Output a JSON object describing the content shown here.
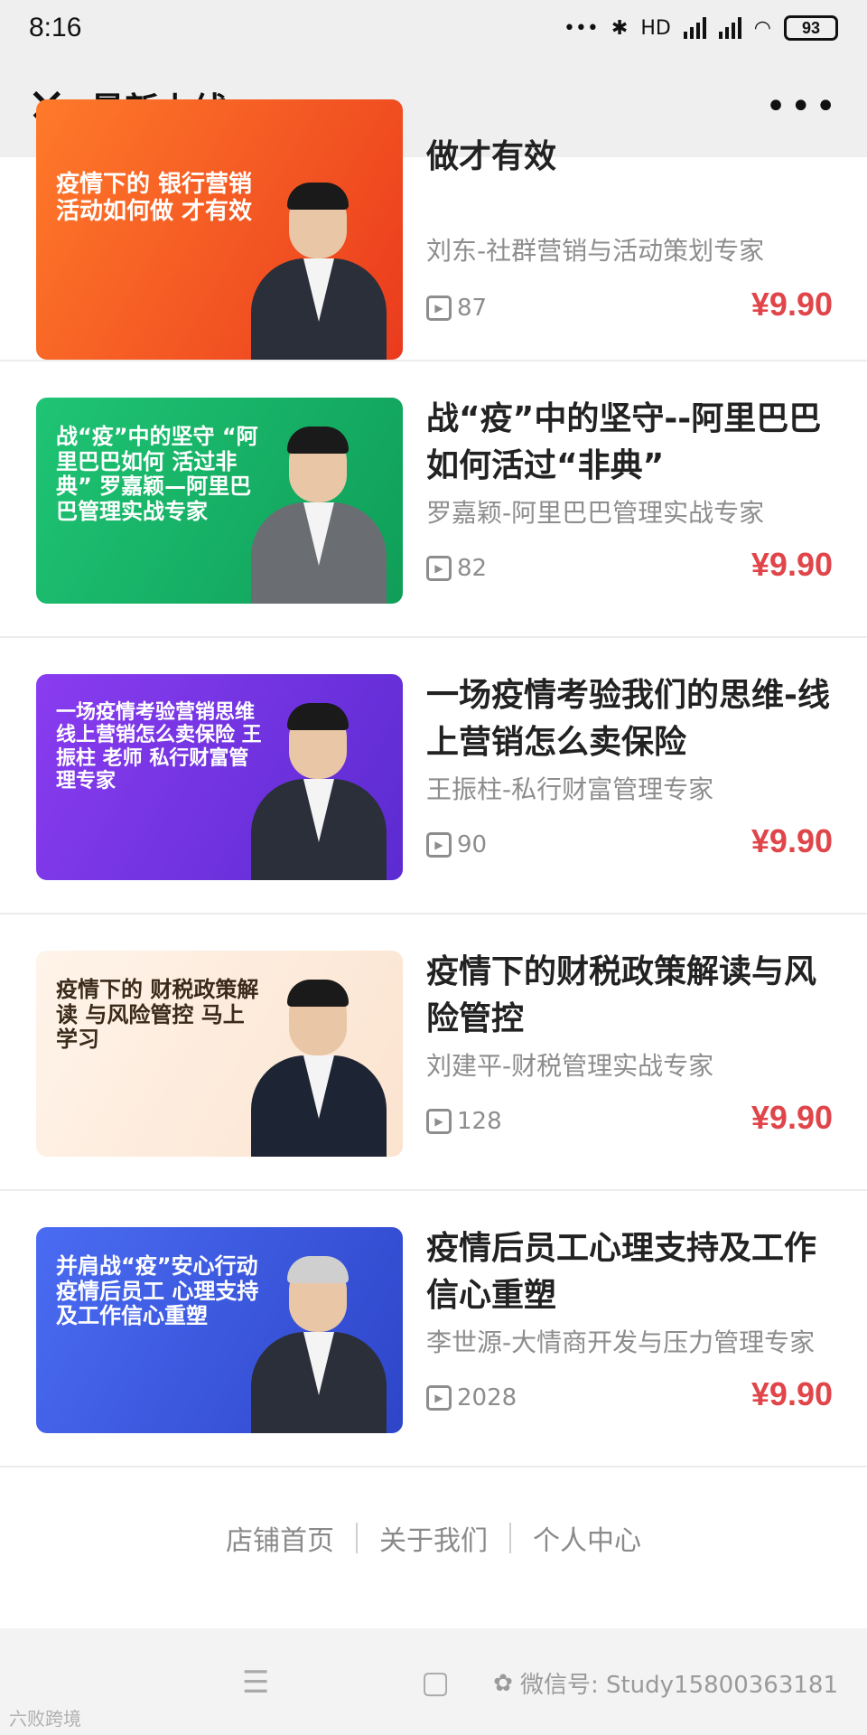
{
  "status_bar": {
    "time": "8:16",
    "signal_label": "HD",
    "battery": "93"
  },
  "header": {
    "title": "最新上线",
    "close_icon": "close-icon",
    "more_icon": "more-icon"
  },
  "courses": [
    {
      "title": "做才有效",
      "author": "刘东-社群营销与活动策划专家",
      "plays": "87",
      "price": "¥9.90",
      "thumb_text": "疫情下的 银行营销活动如何做 才有效",
      "thumb_color": "#f15a24"
    },
    {
      "title": "战“疫”中的坚守--阿里巴巴如何活过“非典”",
      "author": "罗嘉颖-阿里巴巴管理实战专家",
      "plays": "82",
      "price": "¥9.90",
      "thumb_text": "战“疫”中的坚守 “阿里巴巴如何 活过非典” 罗嘉颖—阿里巴巴管理实战专家",
      "thumb_color": "#1fb86b"
    },
    {
      "title": "一场疫情考验我们的思维-线上营销怎么卖保险",
      "author": "王振柱-私行财富管理专家",
      "plays": "90",
      "price": "¥9.90",
      "thumb_text": "一场疫情考验营销思维 线上营销怎么卖保险 王振柱 老师 私行财富管理专家",
      "thumb_color": "#7a3de0"
    },
    {
      "title": "疫情下的财税政策解读与风险管控",
      "author": "刘建平-财税管理实战专家",
      "plays": "128",
      "price": "¥9.90",
      "thumb_text": "疫情下的 财税政策解读 与风险管控 马上学习",
      "thumb_color": "#fbeee2"
    },
    {
      "title": "疫情后员工心理支持及工作信心重塑",
      "author": "李世源-大情商开发与压力管理专家",
      "plays": "2028",
      "price": "¥9.90",
      "thumb_text": "并肩战“疫”安心行动 疫情后员工 心理支持 及工作信心重塑",
      "thumb_color": "#3b5be0"
    }
  ],
  "footer": {
    "links": [
      "店铺首页",
      "关于我们",
      "个人中心"
    ]
  },
  "bottom_nav": {
    "watermark": "微信号: Study15800363181",
    "watermark_left": "六败跨境"
  }
}
